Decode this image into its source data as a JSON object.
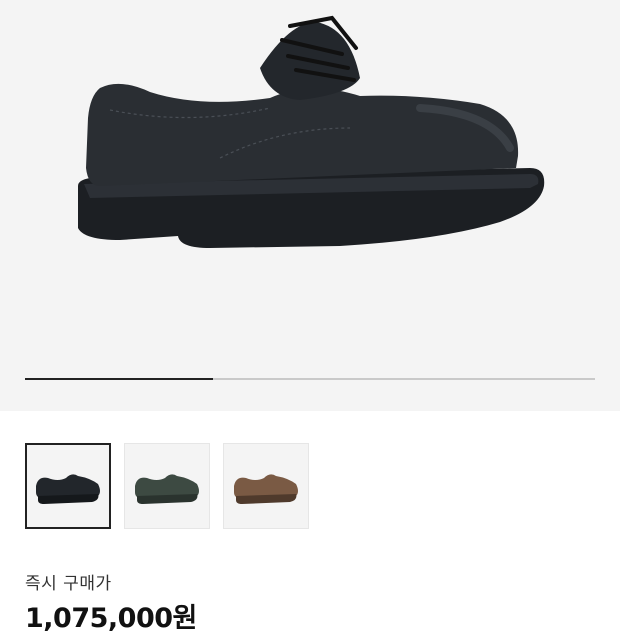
{
  "product": {
    "main_image": "black-derby-shoe-image",
    "gallery_progress": 0.33,
    "variants": [
      {
        "name": "black",
        "color": "#22262b",
        "selected": true
      },
      {
        "name": "olive",
        "color": "#3d4a42",
        "selected": false
      },
      {
        "name": "brown",
        "color": "#7a5a44",
        "selected": false
      }
    ]
  },
  "price": {
    "label": "즉시 구매가",
    "value": "1,075,000원"
  }
}
